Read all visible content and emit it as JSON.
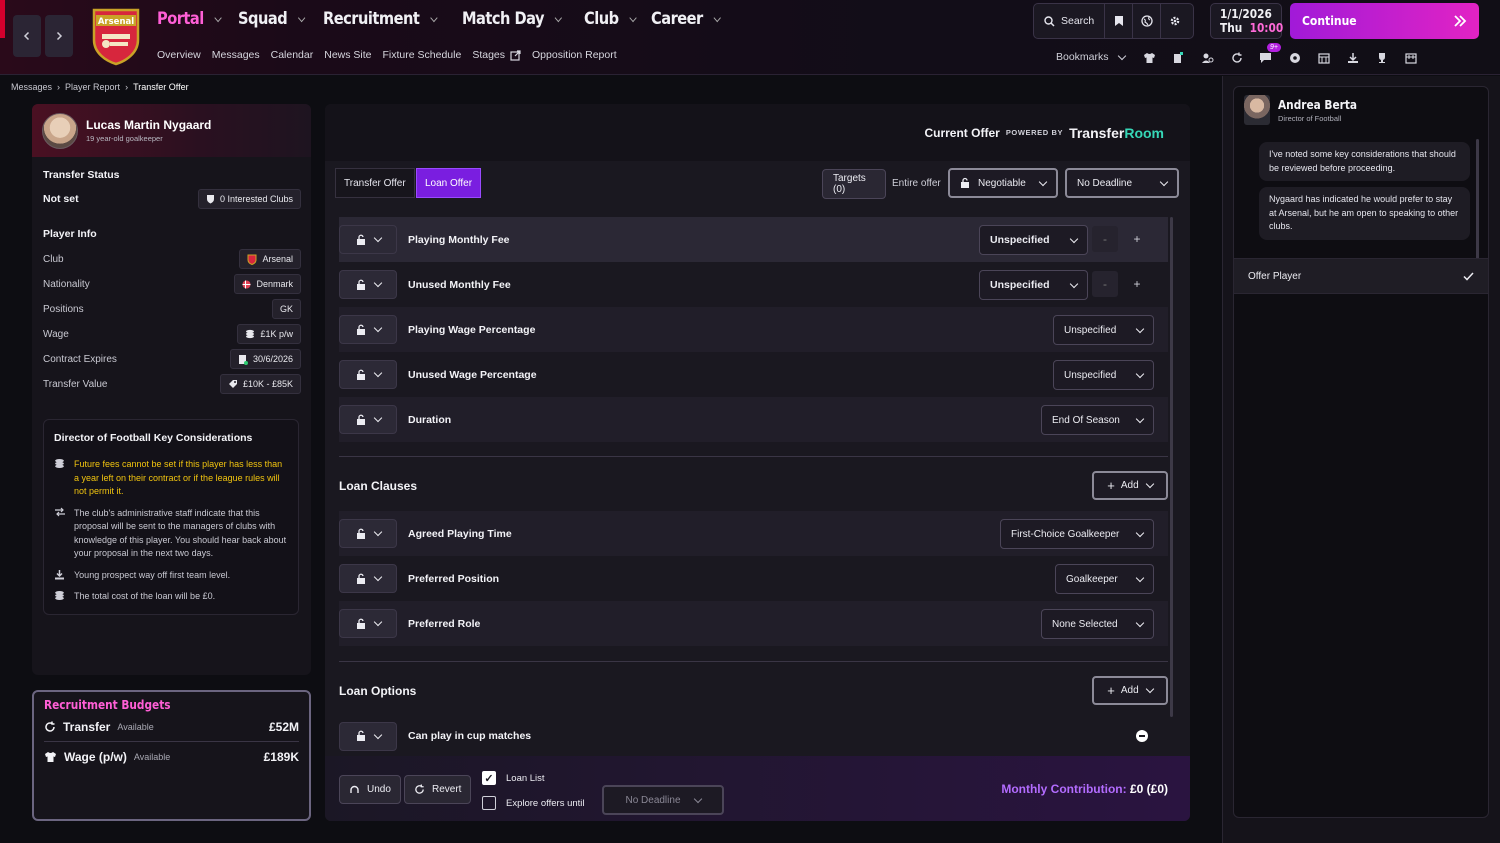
{
  "header": {
    "menu": [
      {
        "label": "Portal",
        "active": true
      },
      {
        "label": "Squad",
        "active": false
      },
      {
        "label": "Recruitment",
        "active": false
      },
      {
        "label": "Match Day",
        "active": false
      },
      {
        "label": "Club",
        "active": false
      },
      {
        "label": "Career",
        "active": false
      }
    ],
    "submenu": [
      "Overview",
      "Messages",
      "Calendar",
      "News Site",
      "Fixture Schedule",
      "Stages",
      "Opposition Report"
    ],
    "crest_text": "Arsenal",
    "search_label": "Search",
    "date": "1/1/2026",
    "day": "Thu",
    "time": "10:00",
    "continue_label": "Continue",
    "bookmarks_label": "Bookmarks",
    "notif_badge": "9+",
    "accent_color": "#ff5fd6"
  },
  "breadcrumb": [
    "Messages",
    "Player Report",
    "Transfer Offer"
  ],
  "player": {
    "name": "Lucas Martin Nygaard",
    "subtitle": "19 year-old goalkeeper",
    "transfer_status_title": "Transfer Status",
    "transfer_status": "Not set",
    "interested_clubs": "0 Interested Clubs",
    "info_title": "Player Info",
    "info": [
      {
        "label": "Club",
        "value": "Arsenal"
      },
      {
        "label": "Nationality",
        "value": "Denmark"
      },
      {
        "label": "Positions",
        "value": "GK"
      },
      {
        "label": "Wage",
        "value": "£1K p/w"
      },
      {
        "label": "Contract Expires",
        "value": "30/6/2026"
      },
      {
        "label": "Transfer Value",
        "value": "£10K - £85K"
      }
    ]
  },
  "dof_considerations": {
    "title": "Director of Football Key Considerations",
    "items": [
      {
        "text": "Future fees cannot be set if this player has less than a year left on their contract or if the league rules will not permit it.",
        "warn": true
      },
      {
        "text": "The club's administrative staff indicate that this proposal will be sent to the managers of clubs with knowledge of this player. You should hear back about your proposal in the next two days.",
        "warn": false
      },
      {
        "text": "Young prospect way off first team level.",
        "warn": false
      },
      {
        "text": "The total cost of the loan will be £0.",
        "warn": false
      }
    ]
  },
  "budgets": {
    "title": "Recruitment Budgets",
    "transfer_label": "Transfer",
    "transfer_sub": "Available",
    "transfer_value": "£52M",
    "wage_label": "Wage (p/w)",
    "wage_sub": "Available",
    "wage_value": "£189K"
  },
  "offer": {
    "current_offer": "Current Offer",
    "powered_by": "POWERED BY",
    "brand_a": "Transfer",
    "brand_b": "Room",
    "tabs": [
      {
        "label": "Transfer Offer",
        "active": false
      },
      {
        "label": "Loan Offer",
        "active": true
      }
    ],
    "targets": "Targets (0)",
    "entire_offer": "Entire offer",
    "negotiable": "Negotiable",
    "deadline": "No Deadline",
    "rows": [
      {
        "label": "Playing Monthly Fee",
        "value": "Unspecified"
      },
      {
        "label": "Unused Monthly Fee",
        "value": "Unspecified"
      },
      {
        "label": "Playing Wage Percentage",
        "value": "Unspecified"
      },
      {
        "label": "Unused Wage Percentage",
        "value": "Unspecified"
      },
      {
        "label": "Duration",
        "value": "End Of Season"
      }
    ],
    "clauses_title": "Loan Clauses",
    "add_label": "Add",
    "clauses": [
      {
        "label": "Agreed Playing Time",
        "value": "First-Choice Goalkeeper"
      },
      {
        "label": "Preferred Position",
        "value": "Goalkeeper"
      },
      {
        "label": "Preferred Role",
        "value": "None Selected"
      }
    ],
    "options_title": "Loan Options",
    "options": [
      {
        "label": "Can play in cup matches"
      }
    ]
  },
  "footer": {
    "undo": "Undo",
    "revert": "Revert",
    "loan_list": "Loan List",
    "loan_list_checked": true,
    "explore": "Explore offers until",
    "explore_checked": false,
    "explore_deadline": "No Deadline",
    "monthly_label": "Monthly Contribution:",
    "monthly_value": "£0 (£0)"
  },
  "dof": {
    "name": "Andrea Berta",
    "role": "Director of Football",
    "messages": [
      "I've noted some key considerations that should be reviewed before proceeding.",
      "Nygaard has indicated he would prefer to stay at Arsenal, but he am open to speaking to other clubs."
    ],
    "offer_player": "Offer Player"
  }
}
